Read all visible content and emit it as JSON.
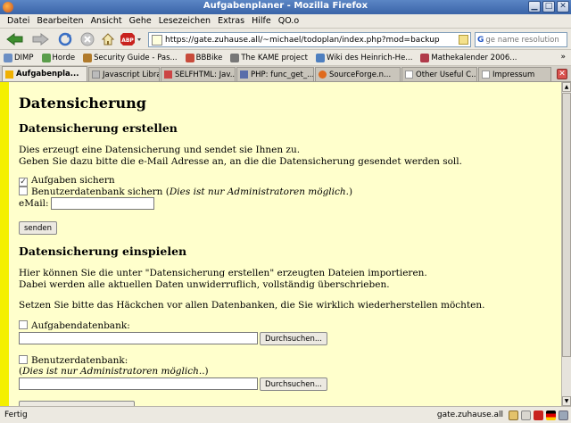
{
  "window": {
    "title": "Aufgabenplaner - Mozilla Firefox"
  },
  "menu": [
    "Datei",
    "Bearbeiten",
    "Ansicht",
    "Gehe",
    "Lesezeichen",
    "Extras",
    "Hilfe",
    "QO.o"
  ],
  "navigation": {
    "url": "https://gate.zuhause.all/~michael/todoplan/index.php?mod=backup",
    "search_placeholder": "ge name resolution",
    "search_engine_glyph": "G"
  },
  "bookmarks": {
    "items": [
      {
        "label": "DIMP",
        "color": "#6c8fc4"
      },
      {
        "label": "Horde",
        "color": "#5a9d4a"
      },
      {
        "label": "Security Guide - Pas...",
        "color": "#b07a2b"
      },
      {
        "label": "BBBike",
        "color": "#c84b3b"
      },
      {
        "label": "The KAME project",
        "color": "#777777"
      },
      {
        "label": "Wiki des Heinrich-He...",
        "color": "#4e7fbf"
      },
      {
        "label": "Mathekalender 2006...",
        "color": "#b03a4a"
      }
    ],
    "more": "»"
  },
  "tabs": [
    {
      "label": "Aufgabenpla...",
      "active": true,
      "color": "#f0b000"
    },
    {
      "label": "Javascript Libra...",
      "active": false,
      "color": "#888888"
    },
    {
      "label": "SELFHTML: Jav...",
      "active": false,
      "color": "#c44"
    },
    {
      "label": "PHP: func_get_...",
      "active": false,
      "color": "#5a6eaa"
    },
    {
      "label": "SourceForge.n...",
      "active": false,
      "color": "#e06a1c"
    },
    {
      "label": "Other Useful C...",
      "active": false,
      "color": "#aaaaaa"
    },
    {
      "label": "Impressum",
      "active": false,
      "color": "#aaaaaa"
    }
  ],
  "page": {
    "heading": "Datensicherung",
    "create": {
      "heading": "Datensicherung erstellen",
      "line1": "Dies erzeugt eine Datensicherung und sendet sie Ihnen zu.",
      "line2": "Geben Sie dazu bitte die e-Mail Adresse an, an die die Datensicherung gesendet werden soll.",
      "checkbox_tasks": {
        "label": "Aufgaben sichern",
        "checked": true
      },
      "checkbox_users": {
        "label": "Benutzerdatenbank sichern (",
        "note": "Dies ist nur Administratoren möglich.",
        "close": ")",
        "checked": false
      },
      "email_label": "eMail:",
      "email_value": "",
      "send_button": "senden"
    },
    "restore": {
      "heading": "Datensicherung einspielen",
      "line1": "Hier können Sie die unter \"Datensicherung erstellen\" erzeugten Dateien importieren.",
      "line2": "Dabei werden alle aktuellen Daten unwiderruflich, vollständig überschrieben.",
      "line3": "Setzen Sie bitte das Häckchen vor allen Datenbanken, die Sie wirklich wiederherstellen möchten.",
      "tasks_db": {
        "label": "Aufgabendatenbank:",
        "checked": false
      },
      "browse_button": "Durchsuchen...",
      "users_db": {
        "label": "Benutzerdatenbank:",
        "note": "Dies ist nur Administratoren möglich.",
        "close": ".)",
        "open": "(",
        "checked": false
      },
      "browse_button_2": "Durchsuchen..."
    }
  },
  "status": {
    "text": "Fertig",
    "host": "gate.zuhause.all"
  }
}
